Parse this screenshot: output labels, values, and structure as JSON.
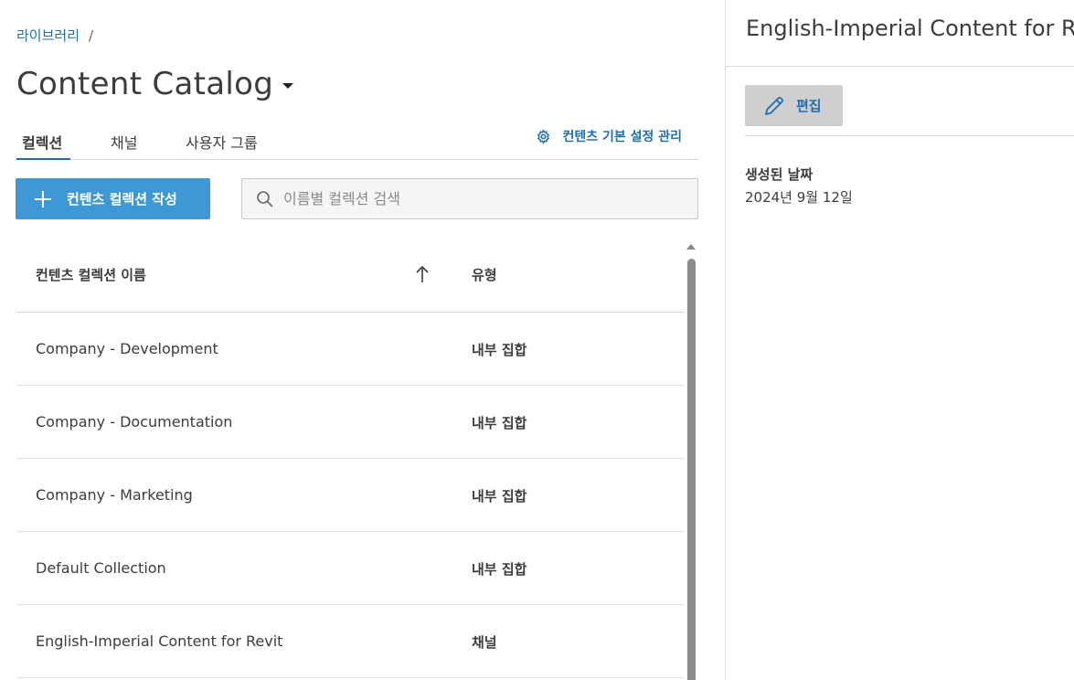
{
  "breadcrumb": {
    "items": [
      "라이브러리"
    ],
    "separator": "/"
  },
  "header": {
    "title": "Content Catalog"
  },
  "tabs": [
    {
      "label": "컬렉션",
      "active": true
    },
    {
      "label": "채널",
      "active": false
    },
    {
      "label": "사용자 그룹",
      "active": false
    }
  ],
  "settings_link": {
    "label": "컨텐츠 기본 설정 관리",
    "icon": "gear-icon"
  },
  "toolbar": {
    "create_label": "컨텐츠 컬렉션 작성",
    "search_placeholder": "이름별 컬렉션 검색"
  },
  "table": {
    "columns": {
      "name": "컨텐츠 컬렉션 이름",
      "type": "유형"
    },
    "sort": "ascending",
    "rows": [
      {
        "name": "Company - Development",
        "type": "내부 집합"
      },
      {
        "name": "Company - Documentation",
        "type": "내부 집합"
      },
      {
        "name": "Company - Marketing",
        "type": "내부 집합"
      },
      {
        "name": "Default Collection",
        "type": "내부 집합"
      },
      {
        "name": "English-Imperial Content for Revit",
        "type": "채널"
      }
    ]
  },
  "panel": {
    "title": "English-Imperial Content for R",
    "edit_label": "편집",
    "created_label": "생성된 날짜",
    "created_value": "2024년 9월 12일"
  },
  "colors": {
    "accent": "#1f6eb0",
    "primary_button": "#3e98d6",
    "edit_button": "#cfcfcf"
  }
}
